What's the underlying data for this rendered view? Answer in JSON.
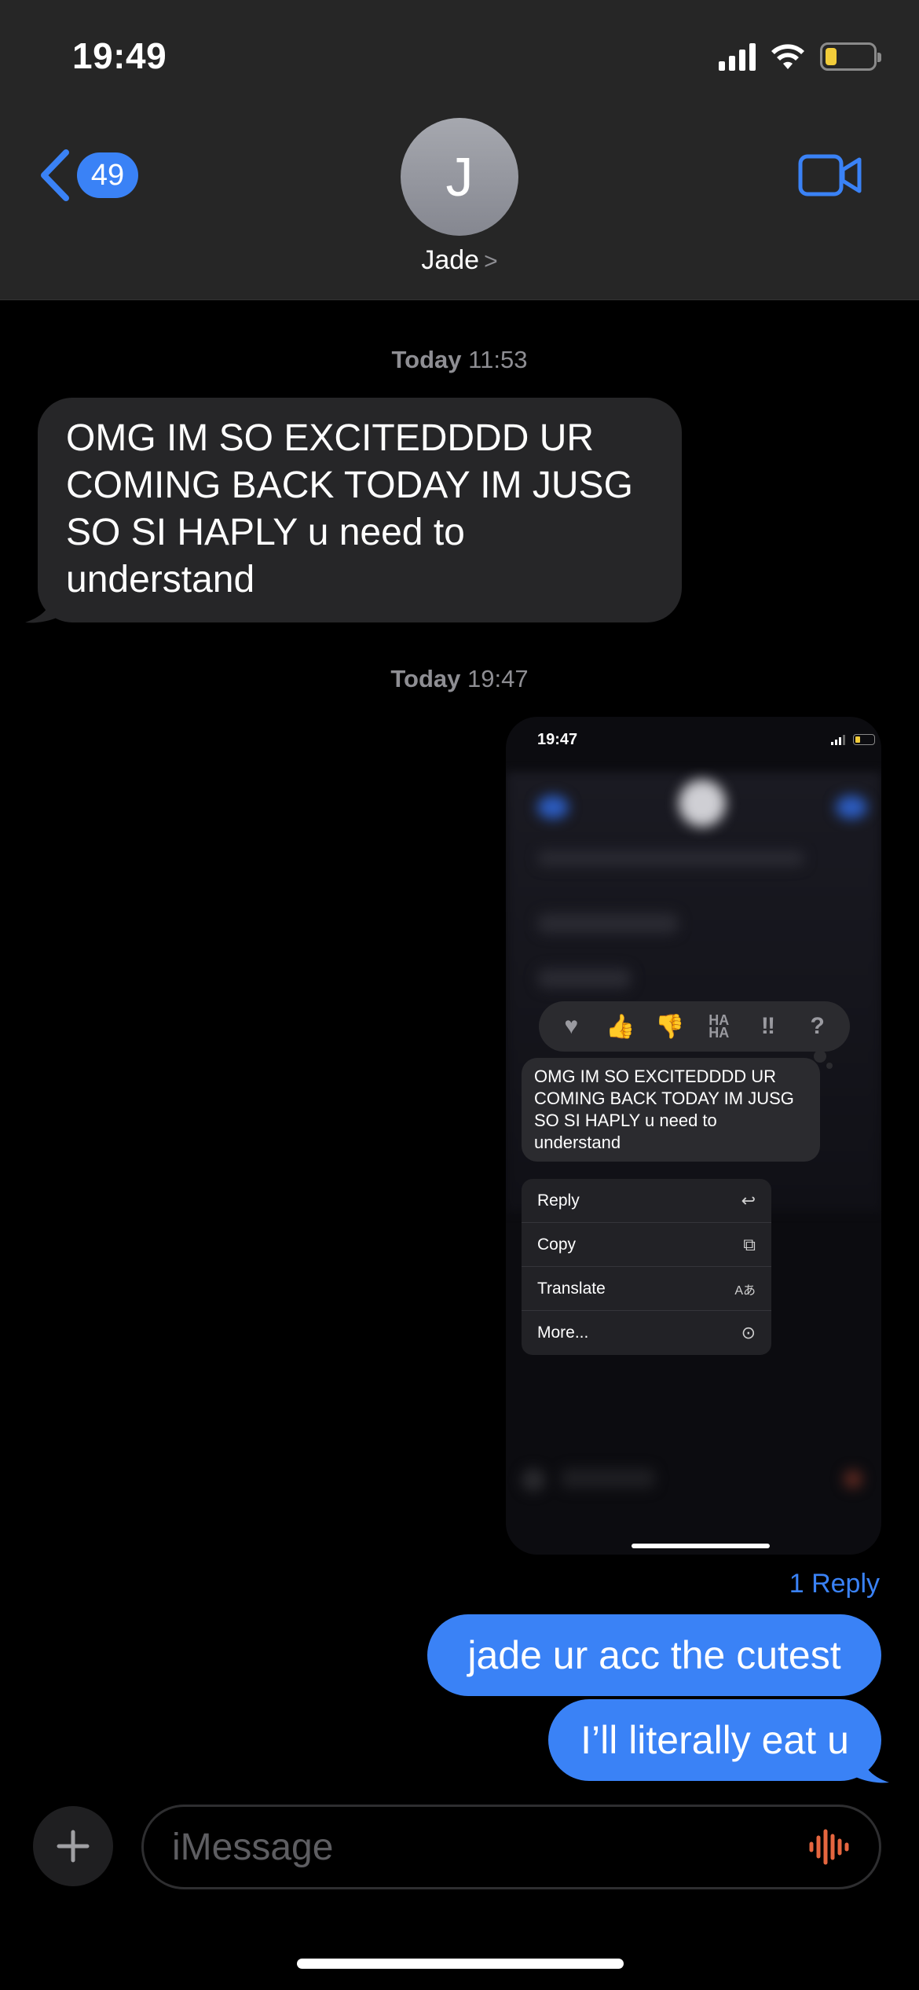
{
  "status_bar": {
    "time": "19:49"
  },
  "header": {
    "back_count": "49",
    "avatar_initial": "J",
    "contact_name": "Jade",
    "contact_chevron": ">"
  },
  "messages": {
    "timestamp_1": {
      "day": "Today",
      "time": "11:53"
    },
    "incoming_1": "OMG IM SO EXCITEDDDD UR COMING BACK TODAY IM JUSG SO SI HAPLY u need to understand",
    "timestamp_2": {
      "day": "Today",
      "time": "19:47"
    },
    "attachment": {
      "time": "19:47",
      "tapbacks": [
        "♥",
        "👍",
        "👎",
        "HA HA",
        "‼",
        "?"
      ],
      "bubble_text": "OMG IM SO EXCITEDDDD UR COMING BACK TODAY IM JUSG SO SI HAPLY u need to understand",
      "menu": [
        {
          "label": "Reply",
          "icon": "↩"
        },
        {
          "label": "Copy",
          "icon": "⧉"
        },
        {
          "label": "Translate",
          "icon": "Aあ"
        },
        {
          "label": "More...",
          "icon": "⊙"
        }
      ]
    },
    "reply_link": "1 Reply",
    "outgoing_1": "jade ur acc the cutest",
    "outgoing_2": "I’ll literally eat u"
  },
  "composer": {
    "placeholder": "iMessage"
  },
  "colors": {
    "accent": "#3a82f6",
    "incoming_bubble": "#262628",
    "audio_icon": "#e5663f"
  }
}
